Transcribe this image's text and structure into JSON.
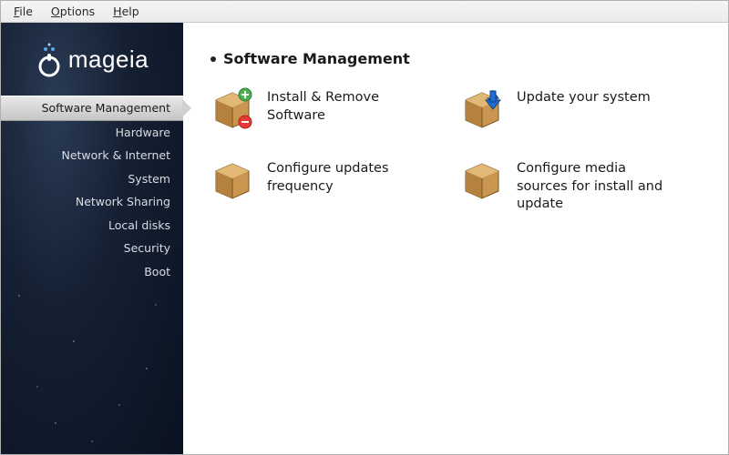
{
  "menubar": {
    "file": "File",
    "options": "Options",
    "help": "Help"
  },
  "brand": "mageia",
  "sidebar": {
    "items": [
      {
        "label": "Software Management",
        "active": true
      },
      {
        "label": "Hardware"
      },
      {
        "label": "Network & Internet"
      },
      {
        "label": "System"
      },
      {
        "label": "Network Sharing"
      },
      {
        "label": "Local disks"
      },
      {
        "label": "Security"
      },
      {
        "label": "Boot"
      }
    ]
  },
  "page": {
    "title": "Software Management",
    "actions": [
      {
        "label": "Install & Remove Software",
        "icon": "install-remove"
      },
      {
        "label": "Update your system",
        "icon": "update"
      },
      {
        "label": "Configure updates frequency",
        "icon": "box"
      },
      {
        "label": "Configure media sources for install and update",
        "icon": "box"
      }
    ]
  }
}
